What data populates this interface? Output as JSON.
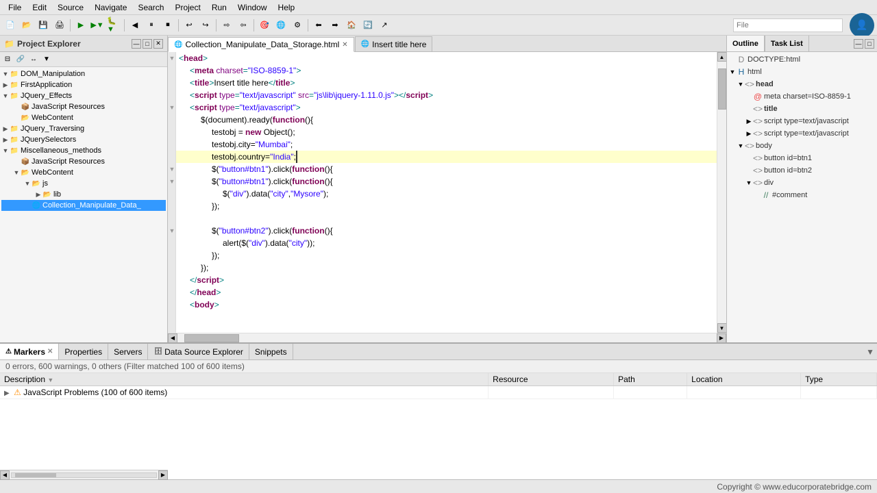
{
  "menubar": {
    "items": [
      "File",
      "Edit",
      "Source",
      "Navigate",
      "Search",
      "Project",
      "Run",
      "Window",
      "Help"
    ]
  },
  "project_panel": {
    "title": "Project Explorer",
    "tree": [
      {
        "id": "dom",
        "label": "DOM_Manipulation",
        "level": 0,
        "type": "project",
        "expanded": true
      },
      {
        "id": "first",
        "label": "FirstApplication",
        "level": 0,
        "type": "project",
        "expanded": false
      },
      {
        "id": "jquery_effects",
        "label": "JQuery_Effects",
        "level": 0,
        "type": "project",
        "expanded": false
      },
      {
        "id": "js_resources1",
        "label": "JavaScript Resources",
        "level": 1,
        "type": "folder"
      },
      {
        "id": "webcontent1",
        "label": "WebContent",
        "level": 1,
        "type": "folder"
      },
      {
        "id": "jquery_traversing",
        "label": "JQuery_Traversing",
        "level": 0,
        "type": "project"
      },
      {
        "id": "jqueryselectors",
        "label": "JQuerySelectors",
        "level": 0,
        "type": "project"
      },
      {
        "id": "misc",
        "label": "Miscellaneous_methods",
        "level": 0,
        "type": "project",
        "expanded": true
      },
      {
        "id": "js_resources2",
        "label": "JavaScript Resources",
        "level": 1,
        "type": "folder"
      },
      {
        "id": "webcontent2",
        "label": "WebContent",
        "level": 1,
        "type": "folder",
        "expanded": true
      },
      {
        "id": "js_folder",
        "label": "js",
        "level": 2,
        "type": "folder",
        "expanded": true
      },
      {
        "id": "lib_folder",
        "label": "lib",
        "level": 3,
        "type": "folder"
      },
      {
        "id": "collection_file",
        "label": "Collection_Manipulate_Data_",
        "level": 2,
        "type": "html",
        "selected": true
      }
    ]
  },
  "tabs": [
    {
      "label": "Collection_Manipulate_Data_Storage.html",
      "active": true,
      "icon": "html"
    },
    {
      "label": "Insert title here",
      "active": false,
      "icon": "globe"
    }
  ],
  "code": {
    "lines": [
      {
        "num": "",
        "indent": 0,
        "content": "<head>",
        "collapse": true,
        "collapsed": false
      },
      {
        "num": "",
        "indent": 1,
        "content": "<meta charset=\"ISO-8859-1\">"
      },
      {
        "num": "",
        "indent": 1,
        "content": "<title>Insert title here</title>"
      },
      {
        "num": "",
        "indent": 1,
        "content": "<script type=\"text/javascript\" src=\"js\\lib\\jquery-1.11.0.js\"></script>"
      },
      {
        "num": "",
        "indent": 1,
        "content": "<script type=\"text/javascript\">",
        "collapse": true
      },
      {
        "num": "",
        "indent": 2,
        "content": "$(document).ready(function(){"
      },
      {
        "num": "",
        "indent": 3,
        "content": "testobj = new Object();"
      },
      {
        "num": "",
        "indent": 3,
        "content": "testobj.city=\"Mumbai\";"
      },
      {
        "num": "",
        "indent": 3,
        "content": "testobj.country=\"India\";",
        "current": true
      },
      {
        "num": "",
        "indent": 3,
        "content": "$(\"button#btn1\").click(function(){",
        "collapse": true
      },
      {
        "num": "",
        "indent": 3,
        "content": "$(\"button#btn1\").click(function(){",
        "collapse": true
      },
      {
        "num": "",
        "indent": 4,
        "content": "$(\"div\").data(\"city\",\"Mysore\");"
      },
      {
        "num": "",
        "indent": 3,
        "content": "});"
      },
      {
        "num": "",
        "indent": 3,
        "content": ""
      },
      {
        "num": "",
        "indent": 3,
        "content": "$(\"button#btn2\").click(function(){",
        "collapse": true
      },
      {
        "num": "",
        "indent": 4,
        "content": "alert($(\"div\").data(\"city\"));"
      },
      {
        "num": "",
        "indent": 3,
        "content": "});"
      },
      {
        "num": "",
        "indent": 2,
        "content": "});"
      },
      {
        "num": "",
        "indent": 1,
        "content": "</script>"
      },
      {
        "num": "",
        "indent": 1,
        "content": "</head>"
      },
      {
        "num": "",
        "indent": 1,
        "content": "<body>"
      }
    ]
  },
  "outline": {
    "tabs": [
      "Outline",
      "Task List"
    ],
    "active_tab": "Outline",
    "tree": [
      {
        "id": "doctype",
        "label": "DOCTYPE:html",
        "level": 0,
        "icon": "doctype"
      },
      {
        "id": "html",
        "label": "html",
        "level": 0,
        "icon": "html",
        "expanded": true
      },
      {
        "id": "head",
        "label": "head",
        "level": 1,
        "icon": "element",
        "expanded": true
      },
      {
        "id": "meta",
        "label": "meta charset=ISO-8859-1",
        "level": 2,
        "icon": "attr"
      },
      {
        "id": "title",
        "label": "title",
        "level": 2,
        "icon": "element"
      },
      {
        "id": "script1",
        "label": "script type=text/javascript",
        "level": 2,
        "icon": "element"
      },
      {
        "id": "script2",
        "label": "script type=text/javascript",
        "level": 2,
        "icon": "element"
      },
      {
        "id": "body",
        "label": "body",
        "level": 1,
        "icon": "element",
        "expanded": true
      },
      {
        "id": "btn1",
        "label": "button id=btn1",
        "level": 2,
        "icon": "element"
      },
      {
        "id": "btn2",
        "label": "button id=btn2",
        "level": 2,
        "icon": "element"
      },
      {
        "id": "div",
        "label": "div",
        "level": 2,
        "icon": "element",
        "expanded": true
      },
      {
        "id": "comment",
        "label": "#comment",
        "level": 3,
        "icon": "comment"
      }
    ]
  },
  "bottom": {
    "tabs": [
      "Markers",
      "Properties",
      "Servers",
      "Data Source Explorer",
      "Snippets"
    ],
    "active_tab": "Markers",
    "status_text": "0 errors, 600 warnings, 0 others (Filter matched 100 of 600 items)",
    "table": {
      "headers": [
        "Description",
        "Resource",
        "Path",
        "Location",
        "Type"
      ],
      "rows": [
        {
          "expand": true,
          "icon": "warning",
          "description": "JavaScript Problems (100 of 600 items)",
          "resource": "",
          "path": "",
          "location": "",
          "type": ""
        }
      ]
    }
  },
  "statusbar": {
    "text": "Copyright © www.educorporatebridge.com"
  }
}
